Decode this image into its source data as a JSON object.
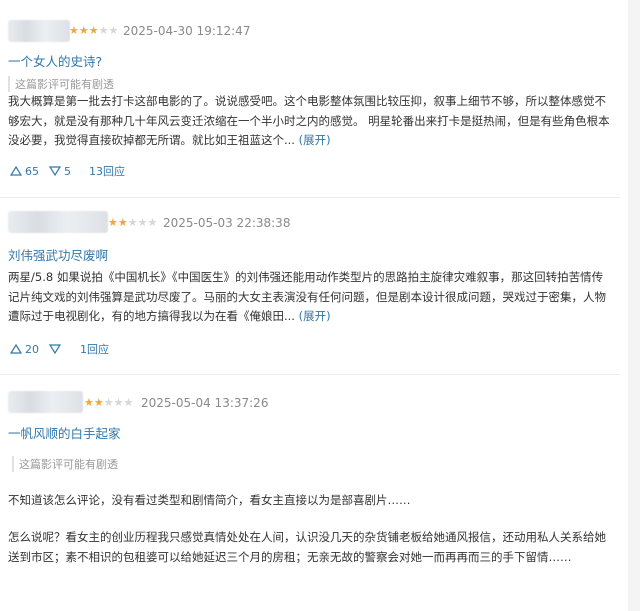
{
  "reviews": [
    {
      "rating": 3,
      "date": "2025-04-30 19:12:47",
      "title": "一个女人的史诗?",
      "spoiler": "这篇影评可能有剧透",
      "body": "我大概算是第一批去打卡这部电影的了。说说感受吧。这个电影整体氛围比较压抑，叙事上细节不够，所以整体感觉不够宏大，就是没有那种几十年风云变迁浓缩在一个半小时之内的感觉。 明星轮番出来打卡是挺热闹，但是有些角色根本没必要，我觉得直接砍掉都无所谓。就比如王祖蓝这个...",
      "expand": "(展开)",
      "up": "65",
      "down": "5",
      "replies": "13回应"
    },
    {
      "rating": 2,
      "date": "2025-05-03 22:38:38",
      "title": "刘伟强武功尽废啊",
      "spoiler": "",
      "body": "两星/5.8 如果说拍《中国机长》《中国医生》的刘伟强还能用动作类型片的思路拍主旋律灾难叙事，那这回转拍苦情传记片纯文戏的刘伟强算是武功尽废了。马丽的大女主表演没有任何问题，但是剧本设计很成问题，哭戏过于密集，人物遭际过于电视剧化，有的地方搞得我以为在看《俺娘田...",
      "expand": "(展开)",
      "up": "20",
      "down": "",
      "replies": "1回应"
    },
    {
      "rating": 2,
      "date": "2025-05-04 13:37:26",
      "title": "一帆风顺的白手起家",
      "spoiler": "这篇影评可能有剧透",
      "body_p1": "不知道该怎么评论，没有看过类型和剧情简介，看女主直接以为是部喜剧片……",
      "body_p2": "怎么说呢？看女主的创业历程我只感觉真情处处在人间，认识没几天的杂货铺老板给她通风报信，还动用私人关系给她送到市区；素不相识的包租婆可以给她延迟三个月的房租；无亲无故的警察会对她一而再再而三的手下留情……"
    }
  ],
  "icons": {
    "up": "thumb-up-triangle",
    "down": "thumb-down-triangle"
  },
  "colors": {
    "link": "#3377aa",
    "star": "#f3a63b",
    "meta": "#8a8a8a"
  }
}
